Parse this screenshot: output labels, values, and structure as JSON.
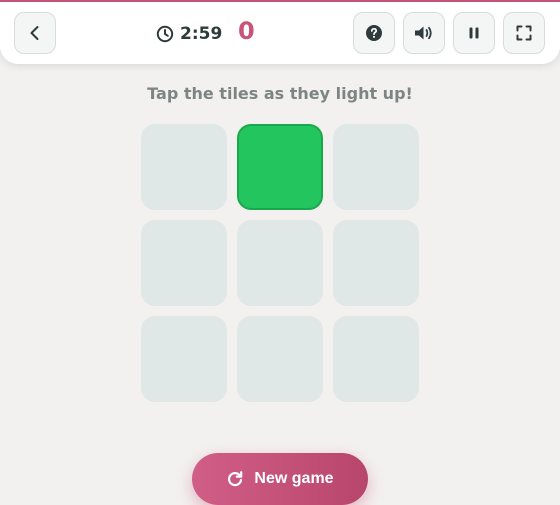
{
  "header": {
    "timer": "2:59",
    "score": "0"
  },
  "instruction": "Tap the tiles as they light up!",
  "grid": {
    "rows": 3,
    "cols": 3,
    "lit_tile_index": 1
  },
  "new_game_label": "New game",
  "colors": {
    "accent": "#c9547a",
    "tile": "#dfe7e7",
    "tile_lit": "#22c55e"
  },
  "icons": {
    "back": "chevron-left-icon",
    "timer": "clock-icon",
    "help": "question-icon",
    "sound": "speaker-icon",
    "pause": "pause-icon",
    "fullscreen": "fullscreen-icon",
    "new_game": "restart-icon"
  }
}
